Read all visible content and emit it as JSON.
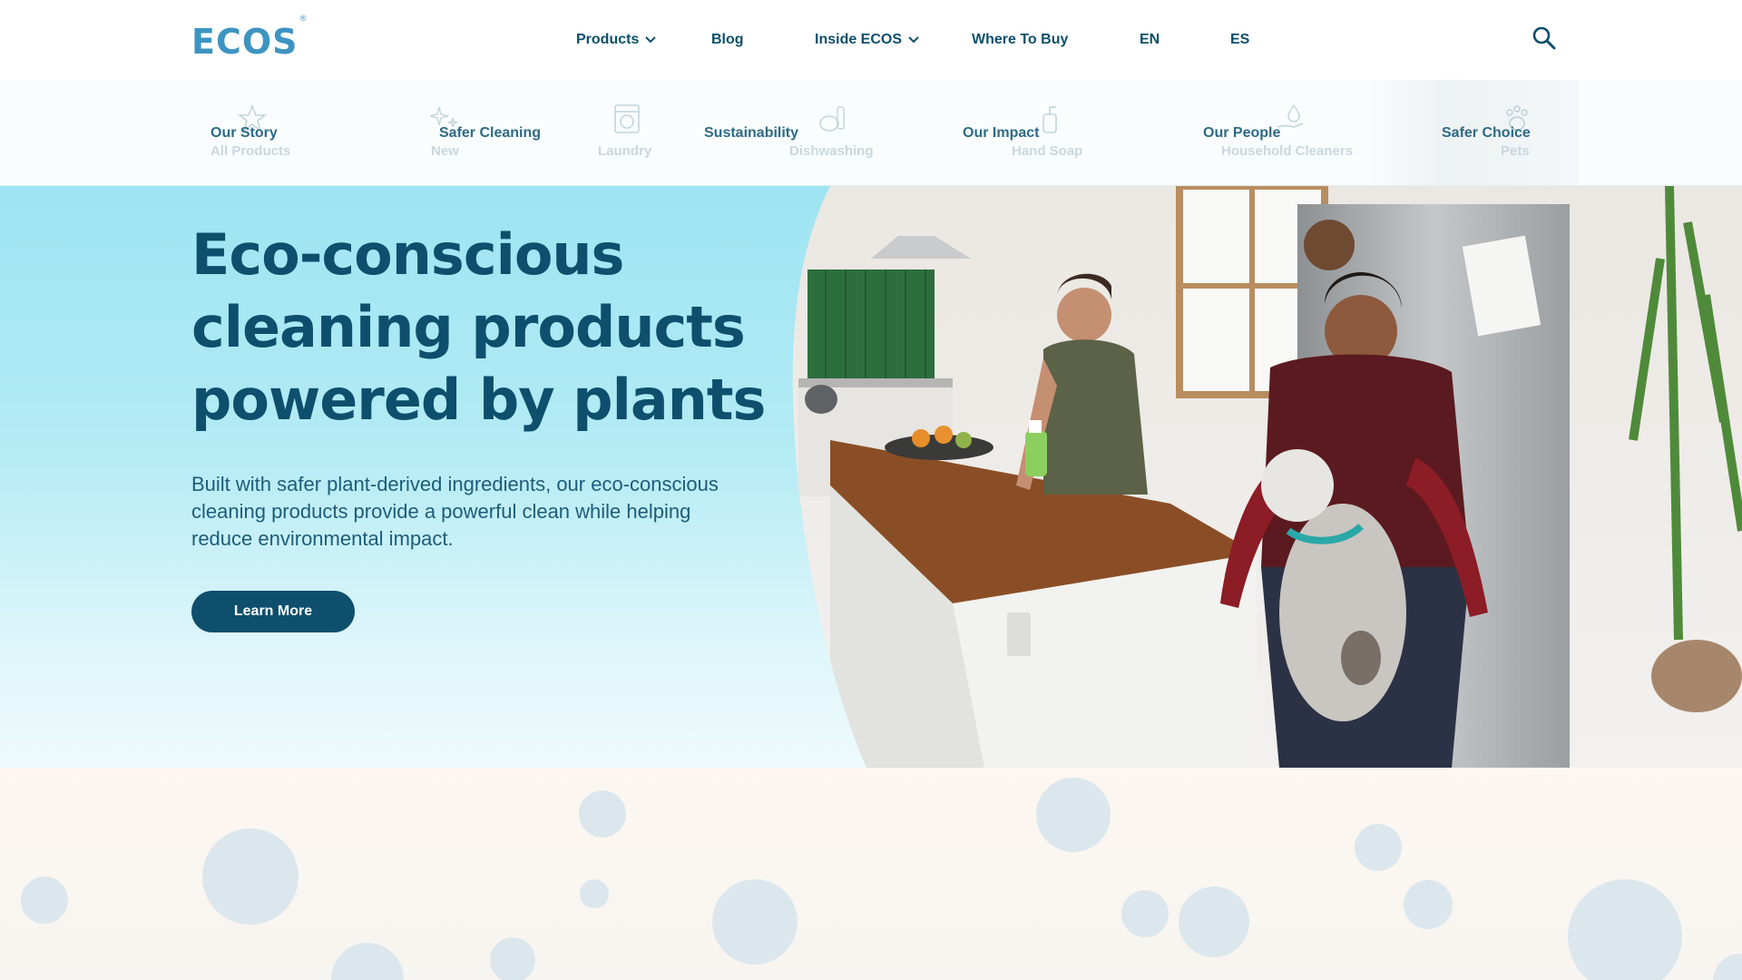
{
  "header": {
    "logo": "ECOS",
    "logo_mark": "®",
    "nav": [
      {
        "label": "Products",
        "has_dropdown": true
      },
      {
        "label": "Blog",
        "has_dropdown": false
      },
      {
        "label": "Inside ECOS",
        "has_dropdown": true
      },
      {
        "label": "Where To Buy",
        "has_dropdown": false
      },
      {
        "label": "EN",
        "has_dropdown": false
      },
      {
        "label": "ES",
        "has_dropdown": false
      }
    ],
    "search_icon": "search-icon"
  },
  "mega_menu": {
    "categories": [
      {
        "label": "All Products",
        "icon": "star-icon"
      },
      {
        "label": "New",
        "icon": "sparkle-icon"
      },
      {
        "label": "Laundry",
        "icon": "washing-machine-icon"
      },
      {
        "label": "Dishwashing",
        "icon": "dishes-icon"
      },
      {
        "label": "Hand Soap",
        "icon": "soap-pump-icon"
      },
      {
        "label": "Household Cleaners",
        "icon": "hand-drop-icon"
      },
      {
        "label": "Pets",
        "icon": "paw-icon"
      }
    ],
    "links": [
      {
        "label": "Our Story"
      },
      {
        "label": "Safer Cleaning"
      },
      {
        "label": "Sustainability"
      },
      {
        "label": "Our Impact"
      },
      {
        "label": "Our People"
      },
      {
        "label": "Safer Choice"
      }
    ]
  },
  "hero": {
    "headline": "Eco-conscious cleaning products powered by plants",
    "subtext": "Built with safer plant-derived ingredients, our eco-conscious cleaning products provide a powerful clean while helping reduce environmental impact.",
    "button_label": "Learn More",
    "image_alt": "family-in-kitchen-photo"
  },
  "colors": {
    "brand_navy": "#0d4f6c",
    "logo_blue": "#3d94c1",
    "hero_sky": "#9ee4f2",
    "bubble": "#dbe7ec"
  }
}
